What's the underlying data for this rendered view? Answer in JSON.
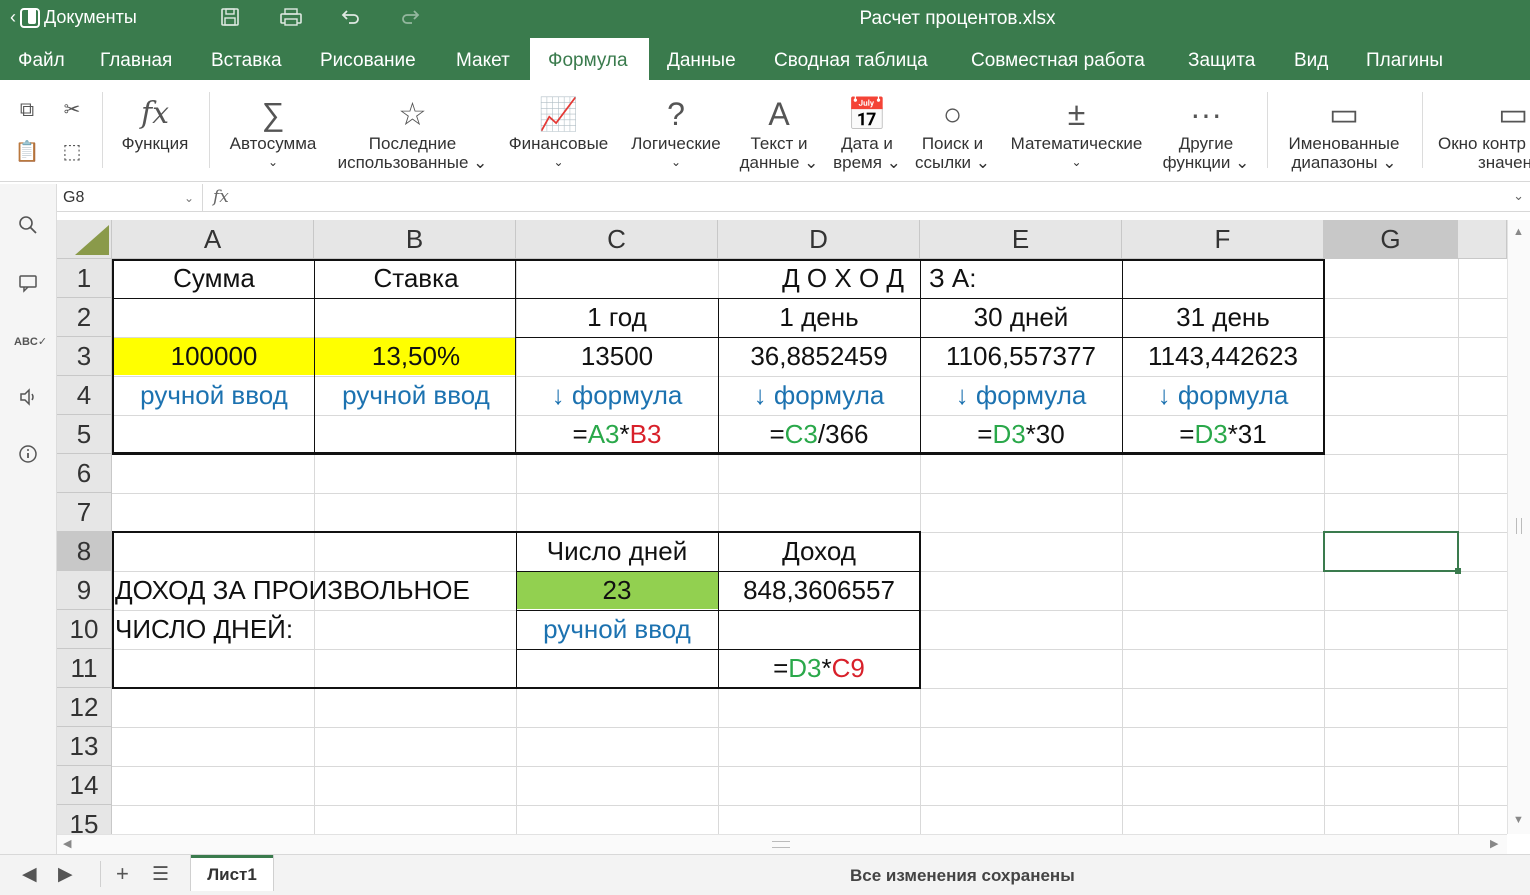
{
  "titlebar": {
    "back_label": "Документы",
    "doc_title": "Расчет процентов.xlsx",
    "icons": [
      "save-icon",
      "print-icon",
      "undo-icon",
      "redo-icon"
    ]
  },
  "menu": {
    "items": [
      "Файл",
      "Главная",
      "Вставка",
      "Рисование",
      "Макет",
      "Формула",
      "Данные",
      "Сводная таблица",
      "Совместная работа",
      "Защита",
      "Вид",
      "Плагины"
    ],
    "active": "Формула"
  },
  "ribbon": {
    "function": "Функция",
    "autosum": "Автосумма",
    "recent_1": "Последние",
    "recent_2": "использованные",
    "financial": "Финансовые",
    "logical": "Логические",
    "text_1": "Текст и",
    "text_2": "данные",
    "date_1": "Дата и",
    "date_2": "время",
    "lookup_1": "Поиск и",
    "lookup_2": "ссылки",
    "math": "Математические",
    "other_1": "Другие",
    "other_2": "функции",
    "named_1": "Именованные",
    "named_2": "диапазоны",
    "watch_1": "Окно контр",
    "watch_2": "значен"
  },
  "formula_bar": {
    "name_box": "G8",
    "fx_label": "fx",
    "formula": ""
  },
  "grid": {
    "columns": [
      "A",
      "B",
      "C",
      "D",
      "E",
      "F",
      "G"
    ],
    "selected_column": "G",
    "rows": [
      "1",
      "2",
      "3",
      "4",
      "5",
      "6",
      "7",
      "8",
      "9",
      "10",
      "11",
      "12",
      "13",
      "14",
      "15"
    ],
    "selected_row": "8",
    "cells": {
      "A1": "Сумма",
      "B1": "Ставка",
      "D1": "Д О Х О Д",
      "E1": "З А:",
      "C2": "1 год",
      "D2": "1 день",
      "E2": "30 дней",
      "F2": "31 день",
      "A3": "100000",
      "B3": "13,50%",
      "C3": "13500",
      "D3": "36,8852459",
      "E3": "1106,557377",
      "F3": "1143,442623",
      "A4": "ручной ввод",
      "B4": "ручной ввод",
      "C4": "↓ формула",
      "D4": "↓ формула",
      "E4": "↓ формула",
      "F4": "↓ формула",
      "C5": {
        "eq": "=",
        "r1": "A3",
        "op": "*",
        "r2": "B3"
      },
      "D5": {
        "eq": "=",
        "r1": "C3",
        "op": "/366"
      },
      "E5": {
        "eq": "=",
        "r1": "D3",
        "op": "*30"
      },
      "F5": {
        "eq": "=",
        "r1": "D3",
        "op": "*31"
      },
      "C8": "Число дней",
      "D8": "Доход",
      "A9": "ДОХОД ЗА ПРОИЗВОЛЬНОЕ",
      "C9": "23",
      "D9": "848,3606557",
      "A10": "ЧИСЛО ДНЕЙ:",
      "C10": "ручной ввод",
      "D11": {
        "eq": "=",
        "r1": "D3",
        "op": "*",
        "r2": "C9"
      }
    }
  },
  "statusbar": {
    "sheet_tab": "Лист1",
    "status": "Все изменения сохранены"
  },
  "colors": {
    "brand": "#3a7b4d",
    "yellow_fill": "#ffff00",
    "green_fill": "#92d050",
    "blue_text": "#1c72b0",
    "ref_green": "#2aa84a",
    "ref_red": "#d8202a"
  }
}
